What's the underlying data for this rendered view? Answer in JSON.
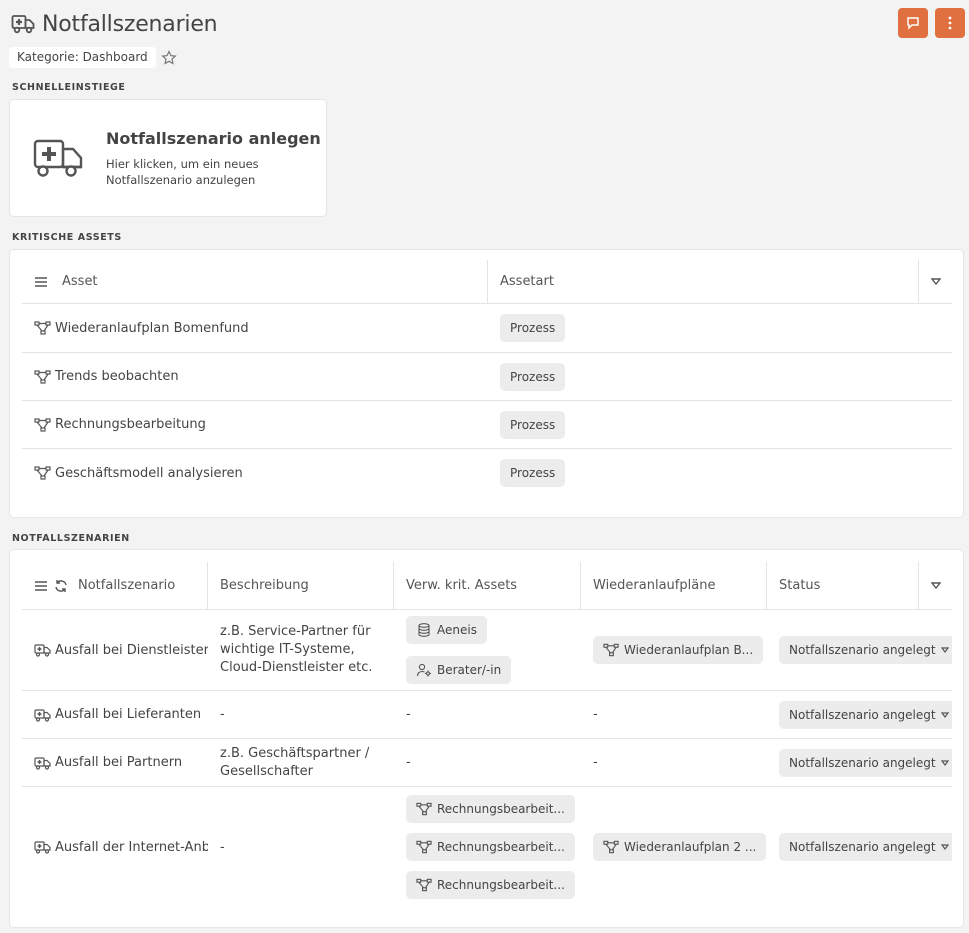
{
  "page": {
    "title": "Notfallszenarien",
    "category": "Kategorie: Dashboard"
  },
  "colors": {
    "accent": "#e07040",
    "pill": "#ececec"
  },
  "sections": {
    "quickstart": "SCHNELLEINSTIEGE",
    "critical_assets": "KRITISCHE ASSETS",
    "scenarios": "NOTFALLSZENARIEN"
  },
  "quick_card": {
    "title": "Notfallszenario anlegen",
    "description": "Hier klicken, um ein neues Notfallszenario anzulegen"
  },
  "assets_table": {
    "headers": [
      "Asset",
      "Assetart"
    ],
    "rows": [
      {
        "name": "Wiederanlaufplan Bomenfund",
        "type": "Prozess"
      },
      {
        "name": "Trends beobachten",
        "type": "Prozess"
      },
      {
        "name": "Rechnungsbearbeitung",
        "type": "Prozess"
      },
      {
        "name": "Geschäftsmodell analysieren",
        "type": "Prozess"
      }
    ]
  },
  "scenario_table": {
    "headers": [
      "Notfallszenario",
      "Beschreibung",
      "Verw. krit. Assets",
      "Wiederanlaufpläne",
      "Status"
    ],
    "rows": [
      {
        "name": "Ausfall bei Dienstleistern",
        "description": "z.B. Service-Partner für wichtige IT-Systeme, Cloud-Dienstleister etc.",
        "assets": [
          "Aeneis",
          "Berater/-in"
        ],
        "plans": "Wiederanlaufplan B...",
        "status": "Notfallszenario angelegt"
      },
      {
        "name": "Ausfall bei Lieferanten",
        "description": "-",
        "assets_text": "-",
        "plans": "-",
        "status": "Notfallszenario angelegt"
      },
      {
        "name": "Ausfall bei Partnern",
        "description": "z.B. Geschäftspartner / Gesellschafter",
        "assets_text": "-",
        "plans": "-",
        "status": "Notfallszenario angelegt"
      },
      {
        "name": "Ausfall der Internet-Anbieter",
        "description": "-",
        "assets": [
          "Rechnungsbearbeit...",
          "Rechnungsbearbeit...",
          "Rechnungsbearbeit..."
        ],
        "plans": "Wiederanlaufplan 2 ...",
        "status": "Notfallszenario angelegt"
      }
    ]
  },
  "icons": {
    "title": "ambulance-icon",
    "process": "process-flow-icon",
    "database": "database-icon",
    "user_gear": "user-gear-icon"
  }
}
